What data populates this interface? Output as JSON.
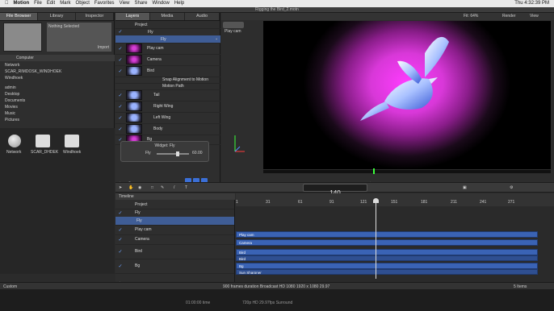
{
  "menubar": {
    "app": "Motion",
    "items": [
      "File",
      "Edit",
      "Mark",
      "Object",
      "Favorites",
      "View",
      "Share",
      "Window",
      "Help"
    ],
    "clock": "Thu 4:32:39 PM"
  },
  "window": {
    "title": "Rigging the Bird_2.motn"
  },
  "left_panel": {
    "tabs": [
      "File Browser",
      "Library",
      "Inspector"
    ],
    "preview_text": "Nothing Selected",
    "import_label": "Import",
    "path_label": "Computer",
    "sources": [
      "Network",
      "SCAR_RIMDOSK_WINDHOEK",
      "Windhoek",
      "admin",
      "Desktop",
      "Documents",
      "Movies",
      "Music",
      "Pictures"
    ],
    "drives": [
      "Network",
      "SCAR_DHDEK",
      "Windhoek"
    ]
  },
  "layers_panel": {
    "tabs": [
      "Layers",
      "Media",
      "Audio"
    ],
    "rows": [
      "Project",
      "Fly",
      "Fly",
      "Play cam",
      "Camera",
      "Bird",
      "Snap Alignment to Motion",
      "Motion Path",
      "Tail",
      "Right Wing",
      "Left Wing",
      "Body",
      "Bg"
    ],
    "widget_title": "Widget: Fly",
    "widget_param": "Fly",
    "widget_value": "60.00"
  },
  "viewer": {
    "camera_select": "Play cam",
    "fit_label": "Fit: 64%",
    "render_label": "Render",
    "view_label": "View"
  },
  "toolbar": {
    "timecode": "140",
    "timecode_sub": "FRAME"
  },
  "timeline": {
    "title": "Timeline",
    "rows": [
      "Project",
      "Fly",
      "Fly",
      "Play cam",
      "Camera",
      "Bird",
      "Bg"
    ],
    "ruler": [
      "1",
      "31",
      "61",
      "91",
      "121",
      "151",
      "181",
      "211",
      "241",
      "271"
    ],
    "bars": [
      "Play cam",
      "Camera",
      "Bird",
      "Bg"
    ],
    "bar_sublabels": [
      "Bird",
      "Sun Sharpner"
    ],
    "status": "900 frames duration Broadcast HD 1080 1920 x 1080 29.97",
    "items_count": "5 Items",
    "bottom_timecode": "01:00:00 time",
    "bottom_format": "720p HD 29.97fps Surround",
    "custom_label": "Custom"
  },
  "colors": {
    "accent": "#3b6fd6",
    "magenta": "#d63dd6",
    "selection": "#3f5d96"
  }
}
